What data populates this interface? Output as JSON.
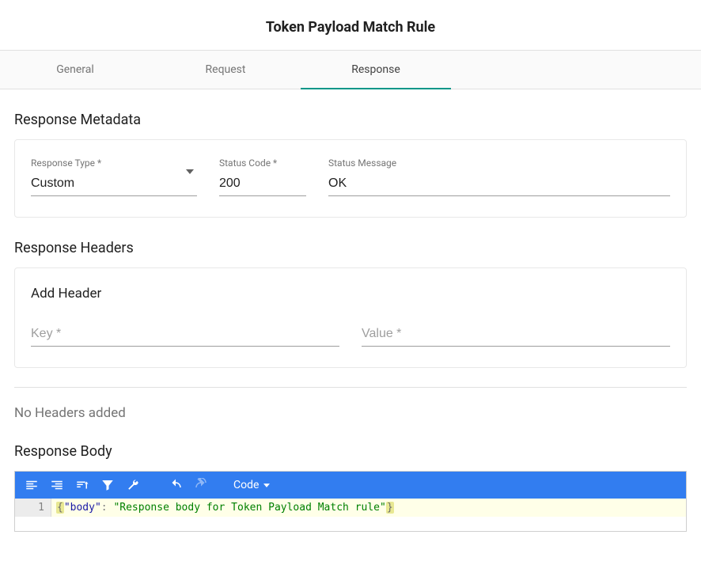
{
  "title": "Token Payload Match Rule",
  "tabs": [
    {
      "label": "General",
      "active": false
    },
    {
      "label": "Request",
      "active": false
    },
    {
      "label": "Response",
      "active": true
    }
  ],
  "responseMetadata": {
    "sectionTitle": "Response Metadata",
    "typeLabel": "Response Type *",
    "typeValue": "Custom",
    "codeLabel": "Status Code *",
    "codeValue": "200",
    "msgLabel": "Status Message",
    "msgValue": "OK"
  },
  "responseHeaders": {
    "sectionTitle": "Response Headers",
    "addTitle": "Add Header",
    "keyLabel": "Key *",
    "keyValue": "",
    "valueLabel": "Value *",
    "valueValue": "",
    "emptyText": "No Headers added"
  },
  "responseBody": {
    "sectionTitle": "Response Body",
    "modeLabel": "Code",
    "lineNumber": "1",
    "json": {
      "openBrace": "{",
      "key": "\"body\"",
      "colon": ": ",
      "value": "\"Response body for Token Payload Match rule\"",
      "closeBrace": "}"
    }
  },
  "icons": {
    "alignLeft": "format-align-left-icon",
    "alignRight": "format-align-right-icon",
    "sort": "sort-icon",
    "filter": "filter-icon",
    "wrench": "wrench-icon",
    "undo": "undo-icon",
    "redo": "redo-icon",
    "caretDown": "caret-down-icon"
  }
}
